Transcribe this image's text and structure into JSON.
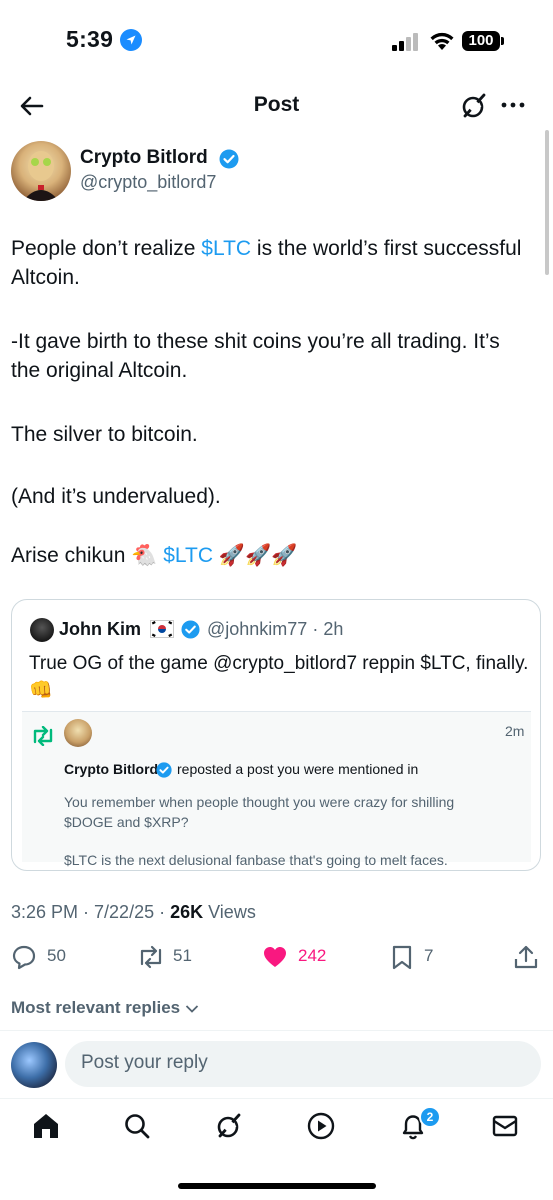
{
  "status_bar": {
    "time": "5:39",
    "battery": "100"
  },
  "header": {
    "title": "Post"
  },
  "author": {
    "name": "Crypto Bitlord",
    "handle": "@crypto_bitlord7"
  },
  "tweet": {
    "p1_before": "People don’t realize ",
    "p1_link": "$LTC",
    "p1_after": " is the world’s first successful Altcoin.",
    "p2": "-It gave birth to these shit coins you’re all trading. It’s the original Altcoin.",
    "p3": "The silver to bitcoin.",
    "p4": "(And it’s undervalued).",
    "p5_before": "Arise chikun 🐔 ",
    "p5_link": "$LTC",
    "p5_after": " 🚀🚀🚀"
  },
  "quote": {
    "name": "John Kim",
    "handle_time": "@johnkim77 · 2h",
    "text": "True OG of the game @crypto_bitlord7 reppin $LTC, finally. 👊",
    "inner": {
      "time": "2m",
      "name": "Crypto Bitlord",
      "action": "reposted a post you were mentioned in",
      "line1": "You remember when people thought you were crazy for shilling $DOGE and $XRP?",
      "line2": "$LTC is the next delusional fanbase that's going to melt faces."
    }
  },
  "meta": {
    "time_date": "3:26 PM · 7/22/25 · ",
    "views_count": "26K",
    "views_label": " Views"
  },
  "actions": {
    "replies": "50",
    "reposts": "51",
    "likes": "242",
    "bookmarks": "7"
  },
  "replies_filter": "Most relevant replies",
  "reply_placeholder": "Post your reply",
  "nav": {
    "notifications_badge": "2"
  },
  "colors": {
    "link": "#1d9bf0",
    "like": "#f91880",
    "repost": "#00ba7c"
  }
}
